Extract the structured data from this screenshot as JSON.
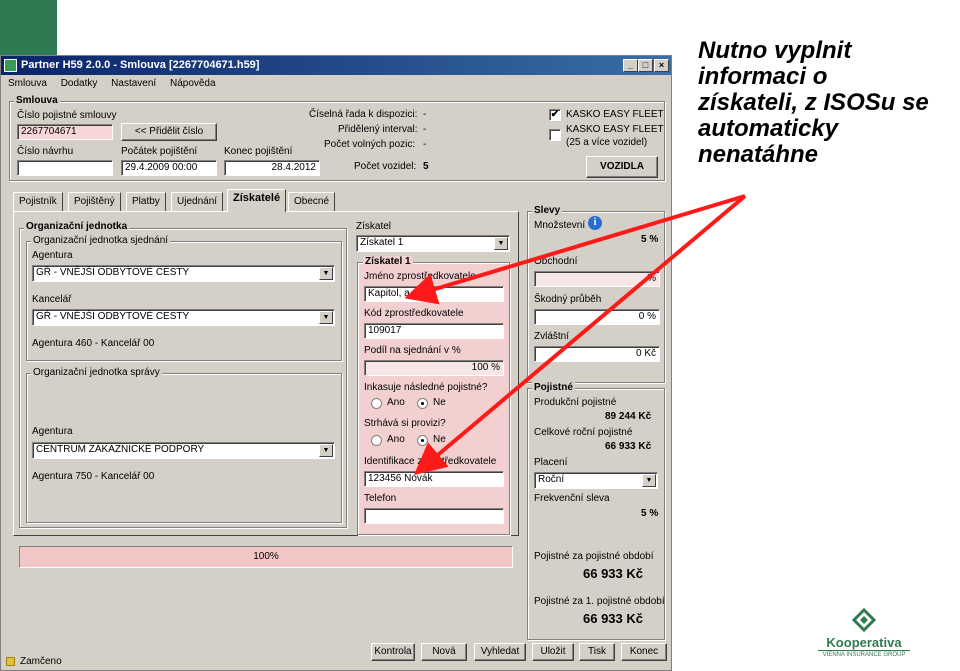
{
  "window": {
    "title": "Partner H59 2.0.0 - Smlouva [2267704671.h59]",
    "min": "_",
    "max": "□",
    "close": "×"
  },
  "menu": [
    "Smlouva",
    "Dodatky",
    "Nastavení",
    "Nápověda"
  ],
  "smlouva": {
    "group_title": "Smlouva",
    "cislo_label": "Číslo pojistné smlouvy",
    "cislo_value": "2267704671",
    "pridelit_label": "<< Přidělit číslo",
    "navrh_label": "Číslo návrhu",
    "navrh_value": "",
    "pocatek_label": "Počátek pojištění",
    "pocatek_value": "29.4.2009 00:00",
    "konec_label": "Konec pojištění",
    "konec_value": "28.4.2012",
    "rada_label": "Číselná řada k dispozici:",
    "rada_value": "-",
    "interval_label": "Přidělený interval:",
    "interval_value": "-",
    "volne_label": "Počet volných pozic:",
    "volne_value": "-",
    "vozidla_label": "Počet vozidel:",
    "vozidla_value": "5",
    "kasko_easy": "KASKO EASY FLEET",
    "kasko_easy_checked": "✔",
    "kasko_fleet": "KASKO EASY FLEET",
    "kasko_fleet_sub": "(25 a více vozidel)",
    "vozidla_btn": "VOZIDLA"
  },
  "tabs": [
    "Pojistník",
    "Pojištěný",
    "Platby",
    "Ujednání",
    "Získatelé",
    "Obecné"
  ],
  "org": {
    "title": "Organizační jednotka",
    "sjednani_title": "Organizační jednotka sjednání",
    "agentura_label": "Agentura",
    "agentura_value": "GŘ - VNĚJŠÍ ODBYTOVÉ CESTY",
    "kancelar_label": "Kancelář",
    "kancelar_value": "GŘ - VNĚJŠÍ ODBYTOVÉ CESTY",
    "agentura_info": "Agentura 460 - Kancelář 00",
    "spravy_title": "Organizační jednotka správy",
    "agentura2_label": "Agentura",
    "agentura2_value": "CENTRUM ZÁKAZNICKÉ PODPORY",
    "agentura2_info": "Agentura 750 - Kancelář 00"
  },
  "ziskatel": {
    "label": "Získatel",
    "select_value": "Získatel 1",
    "group_title": "Získatel 1",
    "jmeno_label": "Jméno zprostředkovatele",
    "jmeno_value": "Kapitol, a.s.",
    "kod_label": "Kód zprostředkovatele",
    "kod_value": "109017",
    "podil_label": "Podíl na sjednání v %",
    "podil_value": "100 %",
    "inkasuje_label": "Inkasuje následné pojistné?",
    "strhava_label": "Strhává si provizi?",
    "ano": "Ano",
    "ne": "Ne",
    "ident_label": "Identifikace zprostředkovatele",
    "ident_value": "123456 Novák",
    "telefon_label": "Telefon",
    "telefon_value": ""
  },
  "progress": {
    "text": "100%",
    "value": 100
  },
  "slevy": {
    "title": "Slevy",
    "mnozstevni_label": "Množstevní",
    "mnozstevni_value": "5 %",
    "obchodni_label": "Obchodní",
    "obchodni_value": "%",
    "skodny_label": "Škodný průběh",
    "skodny_value": "0 %",
    "zvlastni_label": "Zvláštní",
    "zvlastni_value": "0 Kč"
  },
  "pojistne": {
    "title": "Pojistné",
    "produkcni_label": "Produkční pojistné",
    "produkcni_value": "89 244 Kč",
    "celkove_label": "Celkové roční pojistné",
    "celkove_value": "66 933 Kč",
    "placeni_label": "Placení",
    "placeni_value": "Roční",
    "frekvencni_label": "Frekvenční sleva",
    "frekvencni_value": "5 %",
    "obdobi_label": "Pojistné za pojistné období",
    "obdobi_value": "66 933 Kč",
    "prvni_label": "Pojistné za 1. pojistné období",
    "prvni_value": "66 933 Kč"
  },
  "status": {
    "text": "Zamčeno"
  },
  "buttons": [
    "Kontrola",
    "Nová",
    "Vyhledat",
    "Uložit",
    "Tisk",
    "Konec"
  ],
  "annotation": {
    "line1": "Nutno vyplnit",
    "line2": "informaci o",
    "line3": "získateli, z ISOSu se",
    "line4": "automaticky",
    "line5": "nenatáhne"
  },
  "brand": {
    "name": "Kooperativa",
    "tagline": "VIENNA INSURANCE GROUP",
    "color": "#2f7a50"
  },
  "colors": {
    "arrow": "#ff1a1a",
    "pink": "#f3d0d0",
    "titlebar": "#0a246a"
  }
}
